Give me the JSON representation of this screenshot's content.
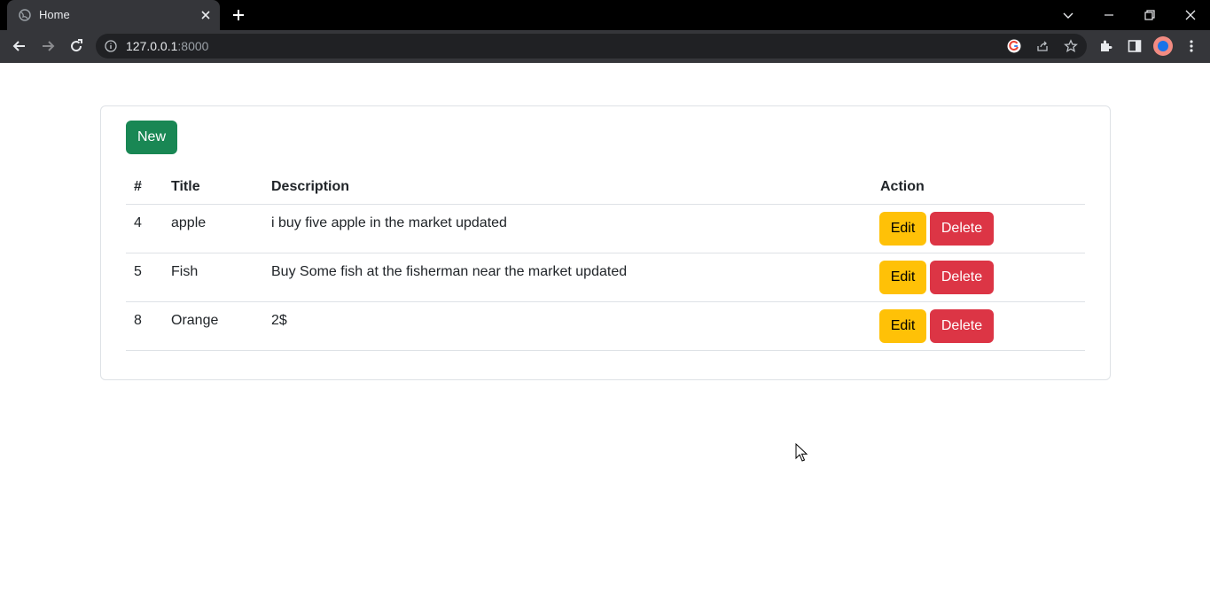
{
  "browser": {
    "tab_title": "Home",
    "url_host": "127.0.0.1",
    "url_port": ":8000"
  },
  "page": {
    "new_button": "New",
    "columns": [
      "#",
      "Title",
      "Description",
      "Action"
    ],
    "rows": [
      {
        "id": "4",
        "title": "apple",
        "description": "i buy five apple in the market updated"
      },
      {
        "id": "5",
        "title": "Fish",
        "description": "Buy Some fish at the fisherman near the market updated"
      },
      {
        "id": "8",
        "title": "Orange",
        "description": "2$"
      }
    ],
    "edit_label": "Edit",
    "delete_label": "Delete"
  },
  "colors": {
    "new": "#198754",
    "edit": "#ffc107",
    "delete": "#dc3545"
  }
}
